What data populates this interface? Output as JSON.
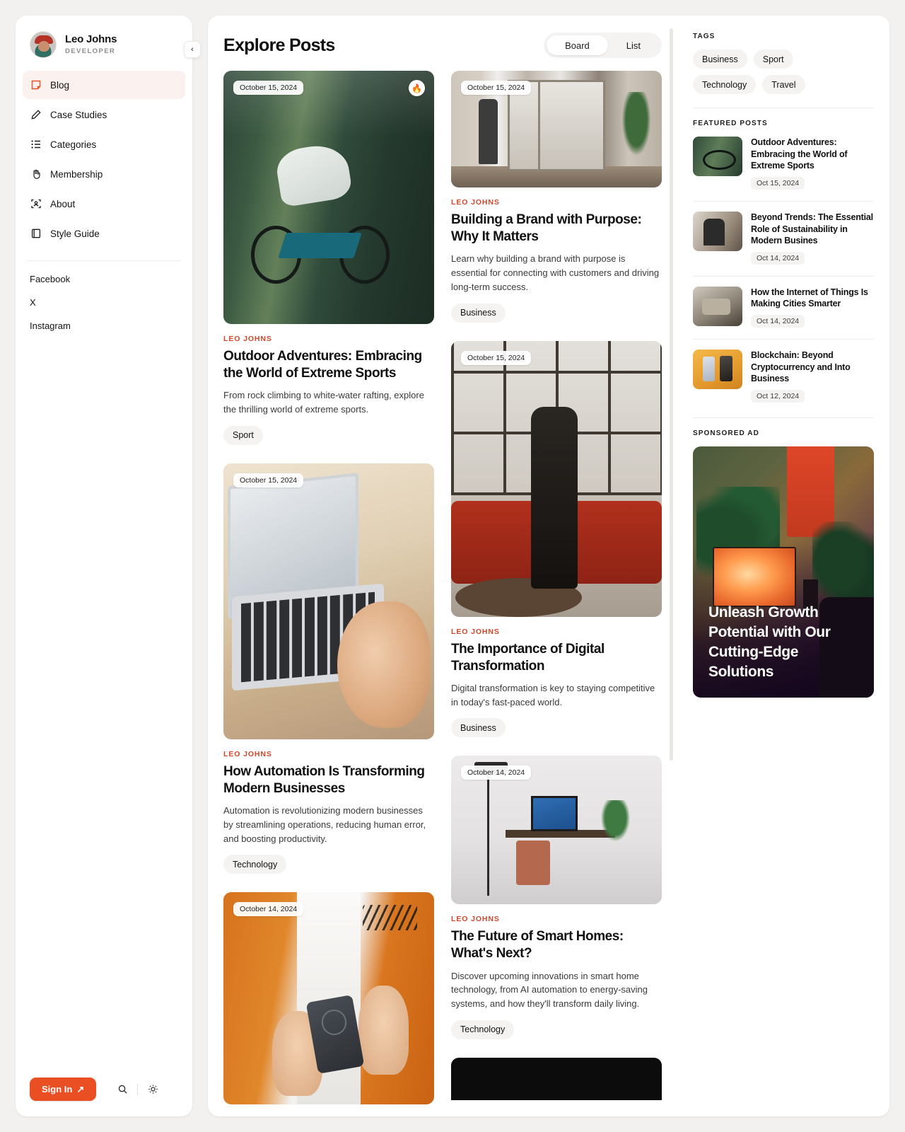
{
  "sidebar": {
    "profile": {
      "name": "Leo Johns",
      "role": "DEVELOPER",
      "avatar_icon": "user-avatar"
    },
    "collapse_icon": "chevron-left-icon",
    "nav": [
      {
        "label": "Blog",
        "icon": "note-icon",
        "active": true
      },
      {
        "label": "Case Studies",
        "icon": "pencil-icon",
        "active": false
      },
      {
        "label": "Categories",
        "icon": "list-icon",
        "active": false
      },
      {
        "label": "Membership",
        "icon": "wave-hand-icon",
        "active": false
      },
      {
        "label": "About",
        "icon": "person-scan-icon",
        "active": false
      },
      {
        "label": "Style Guide",
        "icon": "book-icon",
        "active": false
      }
    ],
    "social": [
      "Facebook",
      "X",
      "Instagram"
    ],
    "footer": {
      "sign_in_label": "Sign In",
      "sign_in_arrow": "↗",
      "search_icon": "search-icon",
      "theme_icon": "sun-icon"
    },
    "accent_color": "#ea4f23"
  },
  "main": {
    "title": "Explore Posts",
    "view_toggle": {
      "options": [
        "Board",
        "List"
      ],
      "selected": "Board"
    },
    "columns": [
      {
        "posts": [
          {
            "date": "October 15, 2024",
            "hot": "🔥",
            "author": "LEO JOHNS",
            "title": "Outdoor Adventures: Embracing the World of Extreme Sports",
            "desc": "From rock climbing to white-water rafting, explore the thrilling world of extreme sports.",
            "tag": "Sport",
            "image": "cyclist-motion-blur"
          },
          {
            "date": "October 15, 2024",
            "author": "LEO JOHNS",
            "title": "How Automation Is Transforming Modern Businesses",
            "desc": "Automation is revolutionizing modern businesses by streamlining operations, reducing human error, and boosting productivity.",
            "tag": "Technology",
            "image": "hands-on-laptop"
          },
          {
            "date": "October 14, 2024",
            "author": "",
            "title": "",
            "desc": "",
            "tag": "",
            "image": "orange-jacket-powerbank"
          }
        ]
      },
      {
        "posts": [
          {
            "date": "October 15, 2024",
            "author": "LEO JOHNS",
            "title": "Building a Brand with Purpose: Why It Matters",
            "desc": "Learn why building a brand with purpose is essential for connecting with customers and driving long-term success.",
            "tag": "Business",
            "image": "office-meeting-pod"
          },
          {
            "date": "October 15, 2024",
            "author": "LEO JOHNS",
            "title": "The Importance of Digital Transformation",
            "desc": "Digital transformation is key to staying competitive in today's fast-paced world.",
            "tag": "Business",
            "image": "woman-in-loft"
          },
          {
            "date": "October 14, 2024",
            "author": "LEO JOHNS",
            "title": "The Future of Smart Homes: What's Next?",
            "desc": "Discover upcoming innovations in smart home technology, from AI automation to energy-saving systems, and how they'll transform daily living.",
            "tag": "Technology",
            "image": "minimal-desk-setup"
          },
          {
            "date": "",
            "author": "",
            "title": "",
            "desc": "",
            "tag": "",
            "image": "dark-card-partial"
          }
        ]
      }
    ]
  },
  "rail": {
    "tags_label": "TAGS",
    "tags": [
      "Business",
      "Sport",
      "Technology",
      "Travel"
    ],
    "featured_label": "FEATURED POSTS",
    "featured": [
      {
        "title": "Outdoor Adventures: Embracing the World of Extreme Sports",
        "date": "Oct 15, 2024",
        "thumb": "cyclist-thumb"
      },
      {
        "title": "Beyond Trends: The Essential Role of Sustainability in Modern Busines",
        "date": "Oct 14, 2024",
        "thumb": "workshop-thumb"
      },
      {
        "title": "How the Internet of Things Is Making Cities Smarter",
        "date": "Oct 14, 2024",
        "thumb": "radio-thumb"
      },
      {
        "title": "Blockchain: Beyond Cryptocurrency and Into Business",
        "date": "Oct 12, 2024",
        "thumb": "phones-thumb"
      }
    ],
    "ad_label": "SPONSORED AD",
    "ad_title": "Unleash Growth Potential with Our Cutting-Edge Solutions"
  }
}
